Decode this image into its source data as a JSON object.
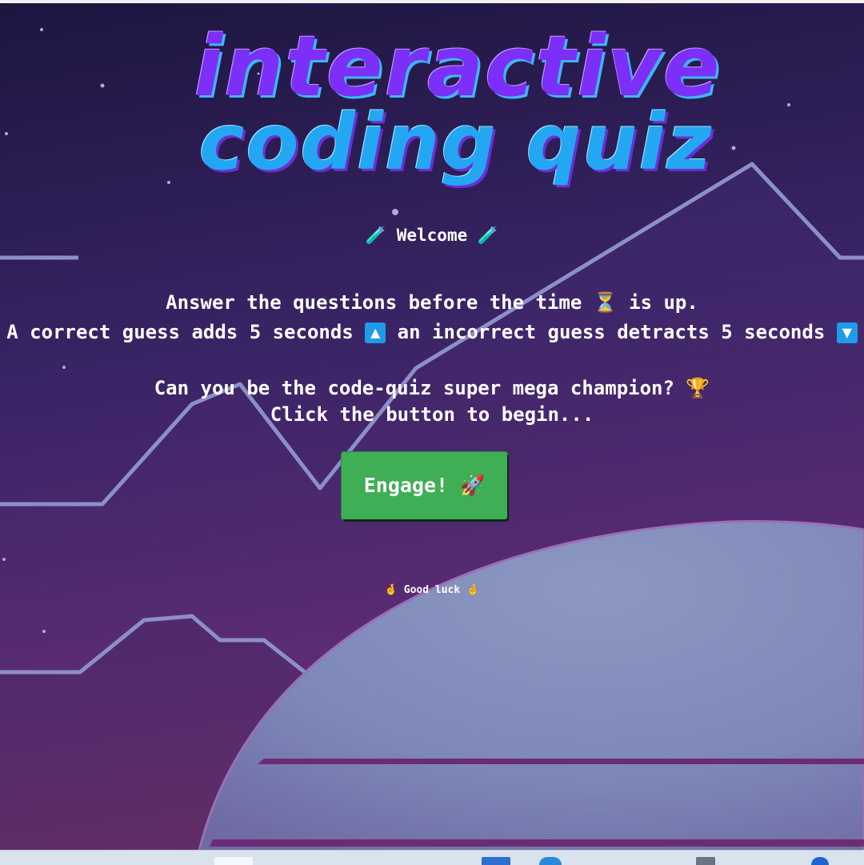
{
  "title": {
    "line1": "interactive",
    "line2": "coding quiz"
  },
  "welcome": {
    "icon_left": "🧪",
    "text": "Welcome",
    "icon_right": "🧪"
  },
  "instructions": {
    "line1_a": "Answer the questions before the time",
    "line1_icon": "⏳",
    "line1_b": "is up.",
    "line2_a": "A correct guess adds 5 seconds",
    "line2_icon_up": "▲",
    "line2_b": "an incorrect guess detracts 5 seconds",
    "line2_icon_down": "▼"
  },
  "challenge": {
    "question": "Can you be the code-quiz super mega champion?",
    "question_icon": "🏆",
    "begin": "Click the button to begin..."
  },
  "engage_button": {
    "label": "Engage!",
    "icon": "🚀",
    "color": "#3fae55"
  },
  "good_luck": {
    "icon_left": "🤞",
    "text": "Good luck",
    "icon_right": "🤞"
  },
  "colors": {
    "sky_top": "#1d1640",
    "sky_bottom": "#6b2f78",
    "planet": "#7f8bb6",
    "title_purple": "#7b2ff7",
    "title_blue": "#24a7f2"
  },
  "icons": [
    "test-tube-icon",
    "hourglass-icon",
    "up-arrow-icon",
    "down-arrow-icon",
    "trophy-icon",
    "rocket-icon",
    "crossed-fingers-icon"
  ]
}
